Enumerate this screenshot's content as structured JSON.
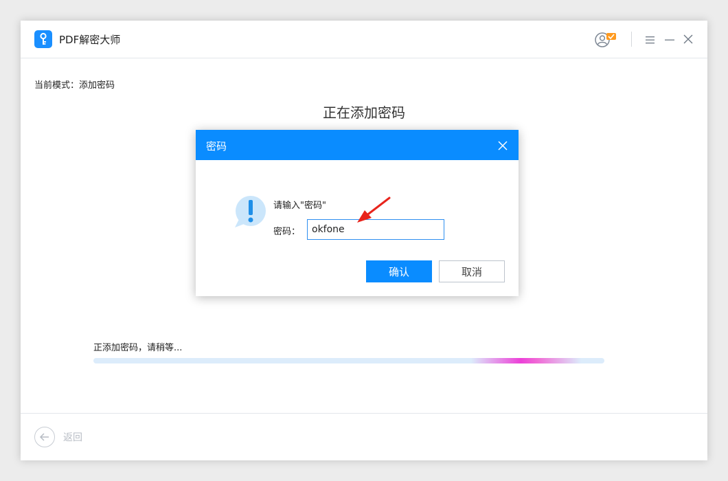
{
  "app": {
    "title": "PDF解密大师"
  },
  "mode": {
    "label": "当前模式：添加密码"
  },
  "main": {
    "heading": "正在添加密码"
  },
  "progress": {
    "label": "正添加密码，请稍等...",
    "highlight_fraction": 0.8
  },
  "footer": {
    "back_label": "返回"
  },
  "dialog": {
    "title": "密码",
    "prompt": "请输入\"密码\"",
    "password_label": "密码：",
    "password_value": "okfone",
    "confirm_label": "确认",
    "cancel_label": "取消"
  },
  "colors": {
    "accent": "#0a8cff",
    "progress_track": "#dcecfb",
    "progress_highlight": "#ec40d8",
    "annotation_arrow": "#e8241c"
  },
  "icons": [
    "key-icon",
    "user-badge-icon",
    "menu-icon",
    "minimize-icon",
    "close-icon",
    "alert-exclamation-icon",
    "back-arrow-icon",
    "annotation-arrow"
  ]
}
